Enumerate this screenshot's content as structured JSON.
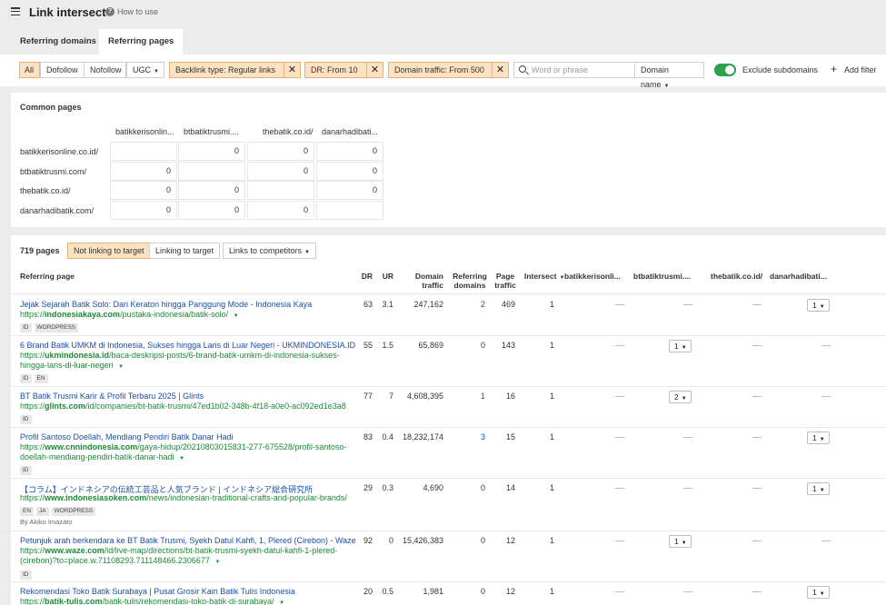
{
  "header": {
    "title": "Link intersect",
    "help_label": "How to use"
  },
  "tabs": [
    {
      "label": "Referring domains"
    },
    {
      "label": "Referring pages"
    }
  ],
  "filters": {
    "link_types": [
      "All",
      "Dofollow",
      "Nofollow",
      "UGC"
    ],
    "chips": [
      "Backlink type: Regular links",
      "DR: From 10",
      "Domain traffic: From 500"
    ],
    "search_placeholder": "Word or phrase",
    "scope": "Domain name",
    "exclude_subdomains_label": "Exclude subdomains",
    "exclude_subdomains": true,
    "add_filter_label": "Add filter"
  },
  "common_pages": {
    "title": "Common pages",
    "columns": [
      "batikkerisonlin...",
      "btbatiktrusmi....",
      "thebatik.co.id/",
      "danarhadibati..."
    ],
    "rows": [
      {
        "label": "batikkerisonline.co.id/",
        "cells": [
          "",
          "0",
          "0",
          "0"
        ]
      },
      {
        "label": "btbatiktrusmi.com/",
        "cells": [
          "0",
          "",
          "0",
          "0"
        ]
      },
      {
        "label": "thebatik.co.id/",
        "cells": [
          "0",
          "0",
          "",
          "0"
        ]
      },
      {
        "label": "danarhadibatik.com/",
        "cells": [
          "0",
          "0",
          "0",
          ""
        ]
      }
    ]
  },
  "results": {
    "count": "719 pages",
    "pills": [
      "Not linking to target",
      "Linking to target",
      "Links to competitors"
    ],
    "columns": {
      "page": "Referring page",
      "dr": "DR",
      "ur": "UR",
      "domain_traffic": [
        "Domain",
        "traffic"
      ],
      "ref_domains": [
        "Referring",
        "domains"
      ],
      "page_traffic": [
        "Page",
        "traffic"
      ],
      "intersect": "Intersect",
      "c1": "batikkerisonli...",
      "c2": "btbatiktrusmi....",
      "c3": "thebatik.co.id/",
      "c4": "danarhadibati..."
    },
    "rows": [
      {
        "title": "Jejak Sejarah Batik Solo: Dari Keraton hingga Panggung Mode - Indonesia Kaya",
        "url_pre": "https://",
        "url_domain": "indonesiakaya.com",
        "url_path": "/pustaka-indonesia/batik-solo/",
        "tags": [
          "ID",
          "WORDPRESS"
        ],
        "byline": "",
        "dr": "63",
        "ur": "3.1",
        "domain_traffic": "247,162",
        "ref_domains": "2",
        "page_traffic": "469",
        "intersect": "1",
        "link_value": "1"
      },
      {
        "title": "6 Brand Batik UMKM di Indonesia, Sukses hingga Laris di Luar Negeri - UKMINDONESIA.ID",
        "url_pre": "https://",
        "url_domain": "ukmindonesia.id",
        "url_path": "/baca-deskripsi-posts/6-brand-batik-umkm-di-indonesia-sukses-hingga-laris-di-luar-negeri",
        "tags": [
          "ID",
          "EN"
        ],
        "byline": "",
        "dr": "55",
        "ur": "1.5",
        "domain_traffic": "65,869",
        "ref_domains": "0",
        "page_traffic": "143",
        "intersect": "1",
        "link_value": "1"
      },
      {
        "title": "BT Batik Trusmi Karir & Profil Terbaru 2025 | Glints",
        "url_pre": "https://",
        "url_domain": "glints.com",
        "url_path": "/id/companies/bt-batik-trusmi/47ed1b02-348b-4f18-a0e0-ac092ed1e3a8",
        "tags": [
          "ID"
        ],
        "byline": "",
        "dr": "77",
        "ur": "7",
        "domain_traffic": "4,608,395",
        "ref_domains": "1",
        "page_traffic": "16",
        "intersect": "1",
        "link_value": "2"
      },
      {
        "title": "Profil Santoso Doellah, Mendiang Pendiri Batik Danar Hadi",
        "url_pre": "https://",
        "url_domain": "www.cnnindonesia.com",
        "url_path": "/gaya-hidup/20210803015831-277-675528/profil-santoso-doellah-mendiang-pendiri-batik-danar-hadi",
        "tags": [
          "ID"
        ],
        "byline": "",
        "dr": "83",
        "ur": "0.4",
        "domain_traffic": "18,232,174",
        "ref_domains": "3",
        "page_traffic": "15",
        "intersect": "1",
        "link_value": "1"
      },
      {
        "title": "【コラム】インドネシアの伝統工芸品と人気ブランド | インドネシア総合研究所",
        "url_pre": "https://",
        "url_domain": "www.indonesiasoken.com",
        "url_path": "/news/indonesian-traditional-crafts-and-popular-brands/",
        "tags": [
          "EN",
          "JA",
          "WORDPRESS"
        ],
        "byline": "By Akiko Imazato",
        "dr": "29",
        "ur": "0.3",
        "domain_traffic": "4,690",
        "ref_domains": "0",
        "page_traffic": "14",
        "intersect": "1",
        "link_value": "1"
      },
      {
        "title": "Petunjuk arah berkendara ke BT Batik Trusmi, Syekh Datul Kahfi, 1, Plered (Cirebon) - Waze",
        "url_pre": "https://",
        "url_domain": "www.waze.com",
        "url_path": "/id/live-map/directions/bt-batik-trusmi-syekh-datul-kahfi-1-plered-(cirebon)?to=place.w.71108293.711148466.2306677",
        "tags": [
          "ID"
        ],
        "byline": "",
        "dr": "92",
        "ur": "0",
        "domain_traffic": "15,426,383",
        "ref_domains": "0",
        "page_traffic": "12",
        "intersect": "1",
        "link_value": "1"
      },
      {
        "title": "Rekomendasi Toko Batik Surabaya | Pusat Grosir Kain Batik Tulis Indonesia",
        "url_pre": "https://",
        "url_domain": "batik-tulis.com",
        "url_path": "/batik-tulis/rekomendasi-toko-batik-di-surabaya/",
        "tags": [],
        "byline": "",
        "dr": "20",
        "ur": "0.5",
        "domain_traffic": "1,981",
        "ref_domains": "0",
        "page_traffic": "12",
        "intersect": "1",
        "link_value": "1"
      }
    ]
  },
  "colors": {
    "accent": "#fde2c2",
    "link": "#1c4ea8",
    "url": "#1a8a34",
    "toggle": "#2e9e4f"
  }
}
